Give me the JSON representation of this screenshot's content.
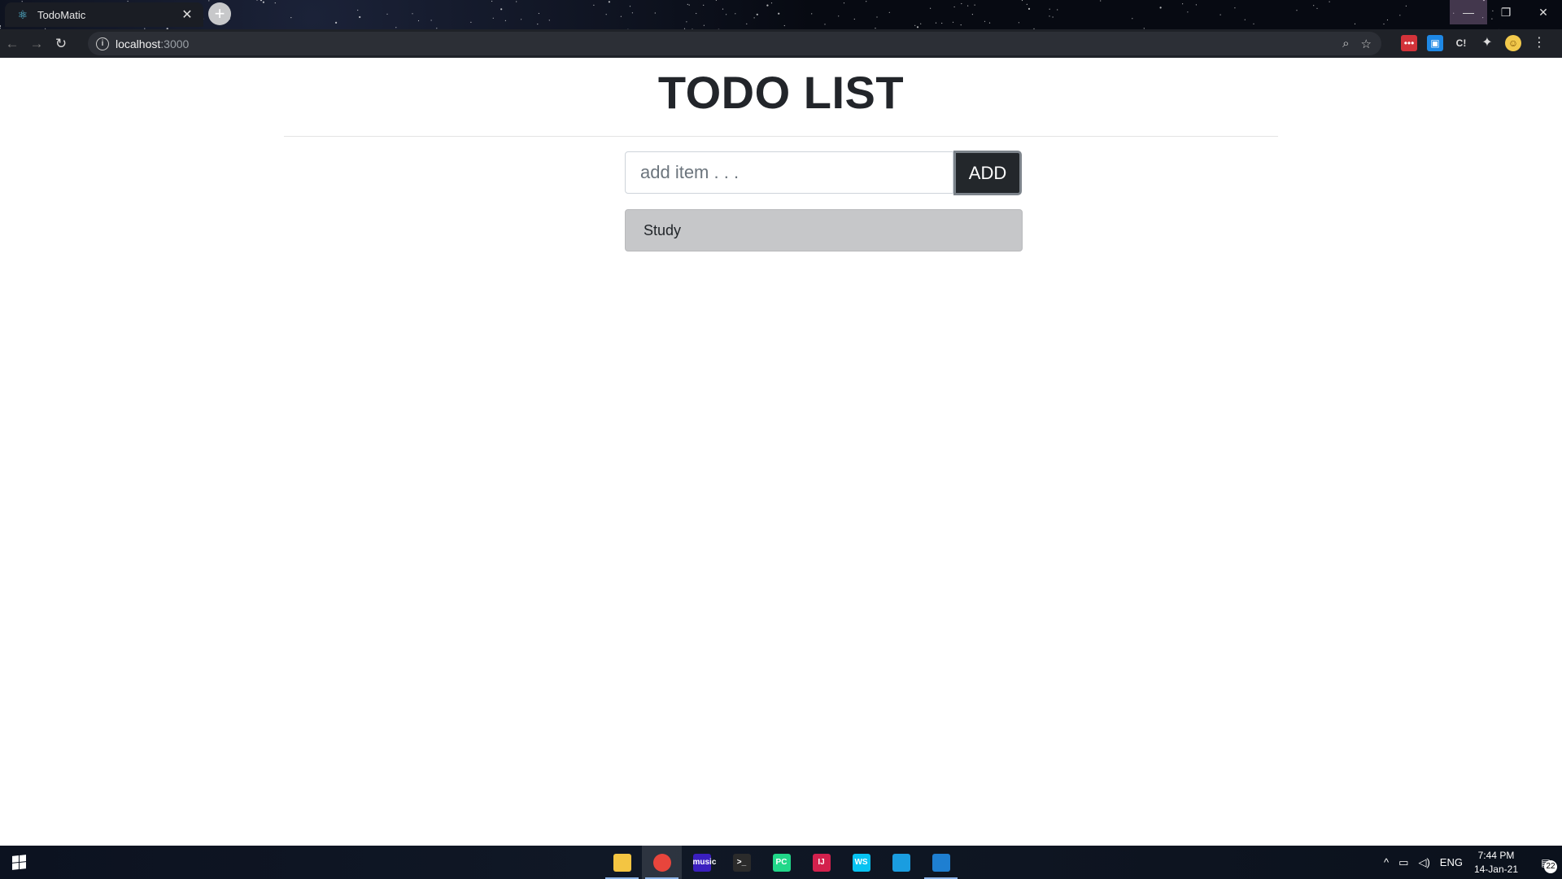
{
  "browser": {
    "tab_title": "TodoMatic",
    "tab_close_glyph": "✕",
    "new_tab_glyph": "+",
    "url_host": "localhost",
    "url_port": ":3000",
    "window_controls": {
      "minimize": "—",
      "restore": "❐",
      "close": "✕"
    }
  },
  "app": {
    "heading": "TODO LIST",
    "input_placeholder": "add item . . .",
    "input_value": "",
    "add_label": "ADD",
    "items": [
      "Study"
    ]
  },
  "taskbar": {
    "language": "ENG",
    "time": "7:44 PM",
    "date": "14-Jan-21",
    "notification_count": "22",
    "apps": [
      {
        "name": "file-explorer",
        "label": "",
        "color": "#f4c542"
      },
      {
        "name": "chrome",
        "label": "",
        "color": "#e8453c"
      },
      {
        "name": "amazon-music",
        "label": "music",
        "color": "#3a1fbf"
      },
      {
        "name": "terminal",
        "label": ">_",
        "color": "#2b2b2b"
      },
      {
        "name": "pycharm",
        "label": "PC",
        "color": "#21d789"
      },
      {
        "name": "intellij",
        "label": "IJ",
        "color": "#d3214d"
      },
      {
        "name": "webstorm",
        "label": "WS",
        "color": "#07c3f2"
      },
      {
        "name": "remote-desktop",
        "label": "",
        "color": "#1a9de0"
      },
      {
        "name": "vscode",
        "label": "",
        "color": "#1e7fd1"
      }
    ]
  },
  "colors": {
    "add_button_bg": "#23272b",
    "item_bg": "#c6c7c9",
    "heading": "#22252a"
  }
}
